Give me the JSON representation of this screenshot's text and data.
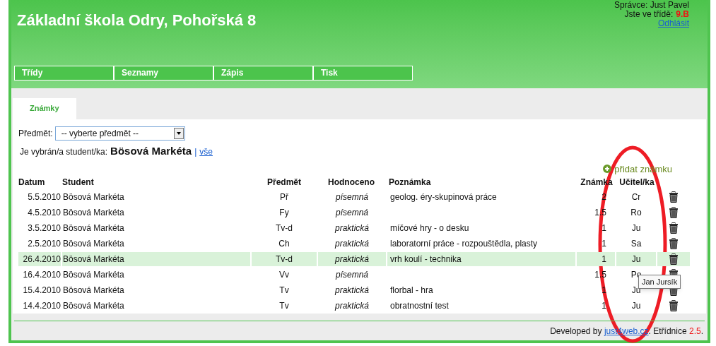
{
  "header": {
    "title": "Základní škola Odry, Pohořská 8",
    "admin": "Správce: Just Pavel",
    "class_label": "Jste ve třídě:",
    "class_value": "9.B",
    "logout": "Odhlásit"
  },
  "nav": [
    {
      "label": "Třídy"
    },
    {
      "label": "Seznamy"
    },
    {
      "label": "Zápis"
    },
    {
      "label": "Tisk"
    }
  ],
  "tabs": [
    {
      "label": "Známky",
      "selected": true
    }
  ],
  "filter": {
    "label": "Předmět:",
    "value": "-- vyberte předmět --"
  },
  "student": {
    "label": "Je vybrán/a student/ka:",
    "name": "Bösová Markéta",
    "separator": "|",
    "all_link": "vše"
  },
  "add_link": "přidat známku",
  "table": {
    "columns": [
      "Datum",
      "Student",
      "Předmět",
      "Hodnoceno",
      "Poznámka",
      "Známka",
      "Učitel/ka"
    ],
    "rows": [
      {
        "date": "5.5.2010",
        "student": "Bösová Markéta",
        "subject": "Př",
        "type": "písemná",
        "note": "geolog. éry-skupinová práce",
        "grade": "2",
        "teacher": "Cr",
        "hovered": false
      },
      {
        "date": "4.5.2010",
        "student": "Bösová Markéta",
        "subject": "Fy",
        "type": "písemná",
        "note": "",
        "grade": "1.5",
        "teacher": "Ro",
        "hovered": false
      },
      {
        "date": "3.5.2010",
        "student": "Bösová Markéta",
        "subject": "Tv-d",
        "type": "praktická",
        "note": "míčové hry - o desku",
        "grade": "1",
        "teacher": "Ju",
        "hovered": false
      },
      {
        "date": "2.5.2010",
        "student": "Bösová Markéta",
        "subject": "Ch",
        "type": "praktická",
        "note": "laboratorní práce - rozpouštědla, plasty",
        "grade": "1",
        "teacher": "Sa",
        "hovered": false
      },
      {
        "date": "26.4.2010",
        "student": "Bösová Markéta",
        "subject": "Tv-d",
        "type": "praktická",
        "note": "vrh koulí - technika",
        "grade": "1",
        "teacher": "Ju",
        "hovered": true
      },
      {
        "date": "16.4.2010",
        "student": "Bösová Markéta",
        "subject": "Vv",
        "type": "písemná",
        "note": "",
        "grade": "1.5",
        "teacher": "Po",
        "hovered": false
      },
      {
        "date": "15.4.2010",
        "student": "Bösová Markéta",
        "subject": "Tv",
        "type": "praktická",
        "note": "florbal - hra",
        "grade": "1",
        "teacher": "Ju",
        "hovered": false
      },
      {
        "date": "14.4.2010",
        "student": "Bösová Markéta",
        "subject": "Tv",
        "type": "praktická",
        "note": "obratnostní test",
        "grade": "1",
        "teacher": "Ju",
        "hovered": false
      }
    ]
  },
  "tooltip": {
    "text": "Jan Jursík"
  },
  "footer": {
    "prefix": "Developed by",
    "link": "just4web.cz",
    "app": ". Etřídnice",
    "version": "2.5",
    "suffix": "."
  }
}
